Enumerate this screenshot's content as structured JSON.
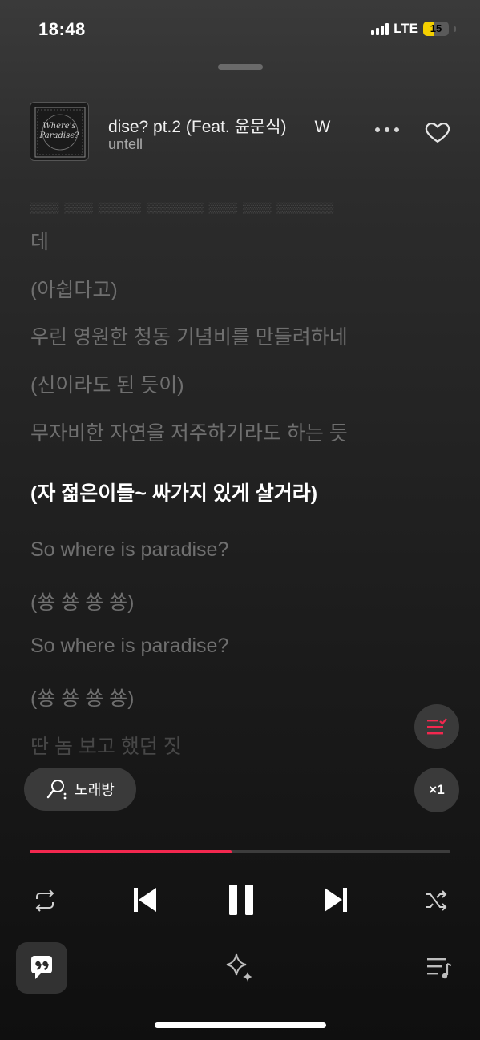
{
  "status_bar": {
    "time": "18:48",
    "network": "LTE",
    "battery": "15"
  },
  "now_playing": {
    "title": "dise? pt.2 (Feat. 윤문식)      W",
    "artist": "untell",
    "album_art": {
      "lines": [
        "Where's",
        "Paradise?"
      ]
    }
  },
  "lyrics": [
    {
      "text": "데",
      "state": "inactive"
    },
    {
      "text": "(아쉽다고)",
      "state": "inactive"
    },
    {
      "text": "우린 영원한 청동 기념비를 만들려하네",
      "state": "inactive"
    },
    {
      "text": "(신이라도 된 듯이)",
      "state": "inactive"
    },
    {
      "text": "무자비한 자연을 저주하기라도 하는 듯",
      "state": "inactive"
    },
    {
      "text": "(자 젊은이들~ 싸가지 있게 살거라)",
      "state": "active"
    },
    {
      "text": "So where is paradise?",
      "state": "inactive"
    },
    {
      "text": "(쑝 쑝 쑝 쑝)",
      "state": "inactive"
    },
    {
      "text": "So where is paradise?",
      "state": "inactive"
    },
    {
      "text": "(쑝 쑝 쑝 쑝)",
      "state": "inactive"
    },
    {
      "text": "딴 놈 보고 했던 짓",
      "state": "faint"
    }
  ],
  "karaoke_button": {
    "label": "노래방",
    "icon": "microphone-icon"
  },
  "speed_button": {
    "label": "×1"
  },
  "progress": {
    "fraction": 0.48
  },
  "colors": {
    "accent": "#f3284f",
    "background": "#1c1c1c"
  },
  "icons": {
    "repeat": "repeat-icon",
    "previous": "skip-back-icon",
    "pause": "pause-icon",
    "next": "skip-forward-icon",
    "shuffle": "shuffle-icon",
    "chat": "quote-bubble-icon",
    "sparkle": "sparkle-icon",
    "playlist": "playlist-icon"
  }
}
